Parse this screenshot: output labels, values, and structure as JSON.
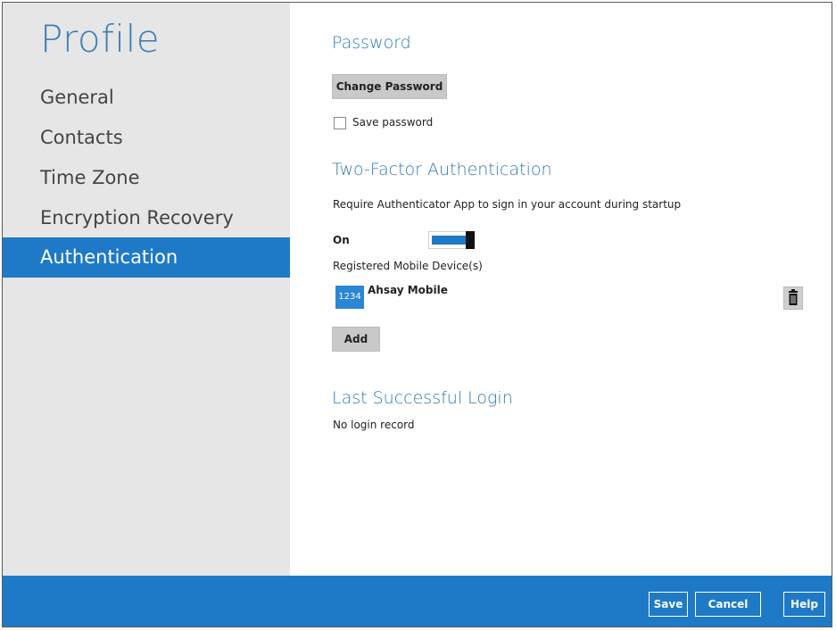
{
  "sidebar": {
    "title": "Profile",
    "items": [
      {
        "label": "General"
      },
      {
        "label": "Contacts"
      },
      {
        "label": "Time Zone"
      },
      {
        "label": "Encryption Recovery"
      },
      {
        "label": "Authentication",
        "active": true
      }
    ]
  },
  "password": {
    "heading": "Password",
    "change_button": "Change Password",
    "save_password_label": "Save password",
    "save_password_checked": false
  },
  "two_factor": {
    "heading": "Two-Factor Authentication",
    "description": "Require Authenticator App to sign in your account during startup",
    "toggle_label": "On",
    "toggle_state": true,
    "devices_label": "Registered Mobile Device(s)",
    "devices": [
      {
        "badge": "1234",
        "name": "Ahsay Mobile",
        "delete_icon": "trash-icon"
      }
    ],
    "add_button": "Add"
  },
  "last_login": {
    "heading": "Last Successful Login",
    "text": "No login record"
  },
  "footer": {
    "save": "Save",
    "cancel": "Cancel",
    "help": "Help"
  },
  "colors": {
    "accent": "#1e7ac6",
    "heading": "#2e79b5",
    "sidebar_bg": "#e6e6e6"
  }
}
